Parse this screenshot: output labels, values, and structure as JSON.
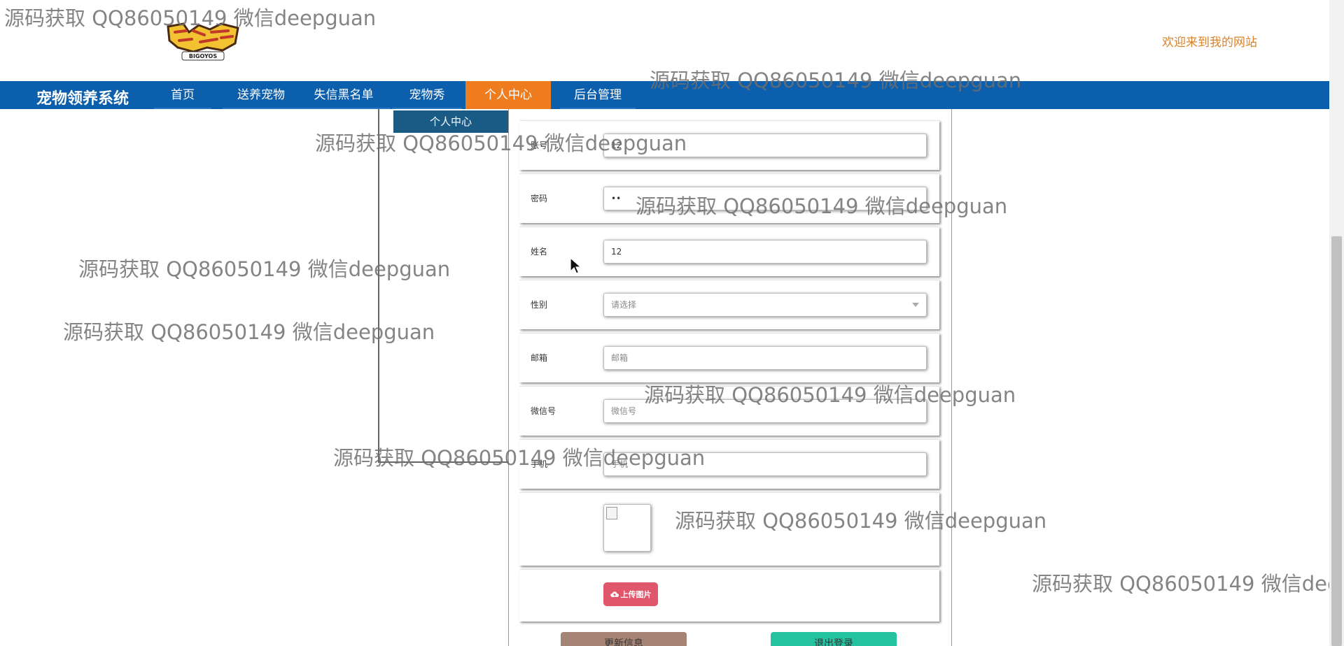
{
  "header": {
    "welcome": "欢迎来到我的网站",
    "logo_text": "BIGOYOS"
  },
  "nav": {
    "brand": "宠物领养系统",
    "items": [
      {
        "label": "首页"
      },
      {
        "label": "送养宠物"
      },
      {
        "label": "失信黑名单"
      },
      {
        "label": "宠物秀"
      },
      {
        "label": "个人中心",
        "active": true
      },
      {
        "label": "后台管理"
      }
    ]
  },
  "sidebar": {
    "title": "个人中心"
  },
  "form": {
    "account": {
      "label": "账号",
      "value": "12"
    },
    "password": {
      "label": "密码",
      "value": "••"
    },
    "name": {
      "label": "姓名",
      "value": "12"
    },
    "gender": {
      "label": "性别",
      "value": "请选择"
    },
    "email": {
      "label": "邮箱",
      "placeholder": "邮箱"
    },
    "wechat": {
      "label": "微信号",
      "placeholder": "微信号"
    },
    "phone": {
      "label": "手机",
      "placeholder": "手机"
    },
    "upload_label": "上传图片",
    "update_label": "更新信息",
    "logout_label": "退出登录"
  },
  "watermark": "源码获取 QQ86050149 微信deepguan",
  "icons": {
    "upload": "cloud-upload-icon",
    "cursor": "mouse-pointer-icon",
    "image": "broken-image-icon"
  },
  "colors": {
    "nav": "#0b5fad",
    "active": "#ef7d20",
    "welcome": "#d9822b",
    "upload": "#e0566b",
    "logout": "#25c2a0",
    "update": "#a58476"
  }
}
